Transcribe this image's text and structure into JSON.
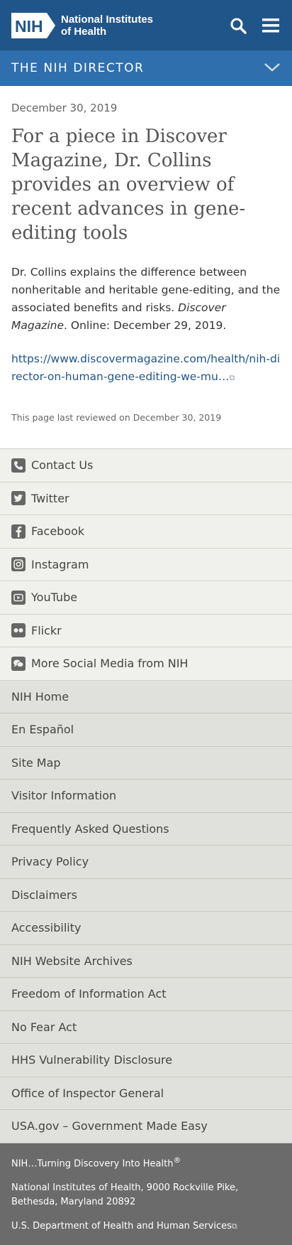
{
  "header": {
    "logo_abbr": "NIH",
    "logo_line1": "National Institutes",
    "logo_line2": "of Health"
  },
  "section": {
    "title": "THE NIH DIRECTOR"
  },
  "article": {
    "date": "December 30, 2019",
    "headline": "For a piece in Discover Magazine, Dr. Collins provides an overview of recent advances in gene-editing tools",
    "body_before": "Dr. Collins explains the difference between nonheritable and heritable gene-editing, and the associated benefits and risks. ",
    "body_italic": "Discover Magazine",
    "body_after": ". Online: December 29, 2019.",
    "link_text": "https://www.discovermagazine.com/health/nih-director-on-human-gene-editing-we-mu…",
    "reviewed": "This page last reviewed on December 30, 2019"
  },
  "social": [
    {
      "label": "Contact Us",
      "icon": "phone-icon"
    },
    {
      "label": "Twitter",
      "icon": "twitter-icon"
    },
    {
      "label": "Facebook",
      "icon": "facebook-icon"
    },
    {
      "label": "Instagram",
      "icon": "instagram-icon"
    },
    {
      "label": "YouTube",
      "icon": "youtube-icon"
    },
    {
      "label": "Flickr",
      "icon": "flickr-icon"
    },
    {
      "label": "More Social Media from NIH",
      "icon": "chat-icon"
    }
  ],
  "footer_links": [
    "NIH Home",
    "En Español",
    "Site Map",
    "Visitor Information",
    "Frequently Asked Questions",
    "Privacy Policy",
    "Disclaimers",
    "Accessibility",
    "NIH Website Archives",
    "Freedom of Information Act",
    "No Fear Act",
    "HHS Vulnerability Disclosure",
    "Office of Inspector General",
    "USA.gov – Government Made Easy"
  ],
  "bottom": {
    "tagline": "NIH…Turning Discovery Into Health",
    "tagline_mark": "®",
    "address": "National Institutes of Health, 9000 Rockville Pike, Bethesda, Maryland 20892",
    "hhs": "U.S. Department of Health and Human Services"
  },
  "colors": {
    "header": "#20558a",
    "section_bar": "#2f6fad",
    "link": "#20558a",
    "footer": "#6b6b6b"
  }
}
